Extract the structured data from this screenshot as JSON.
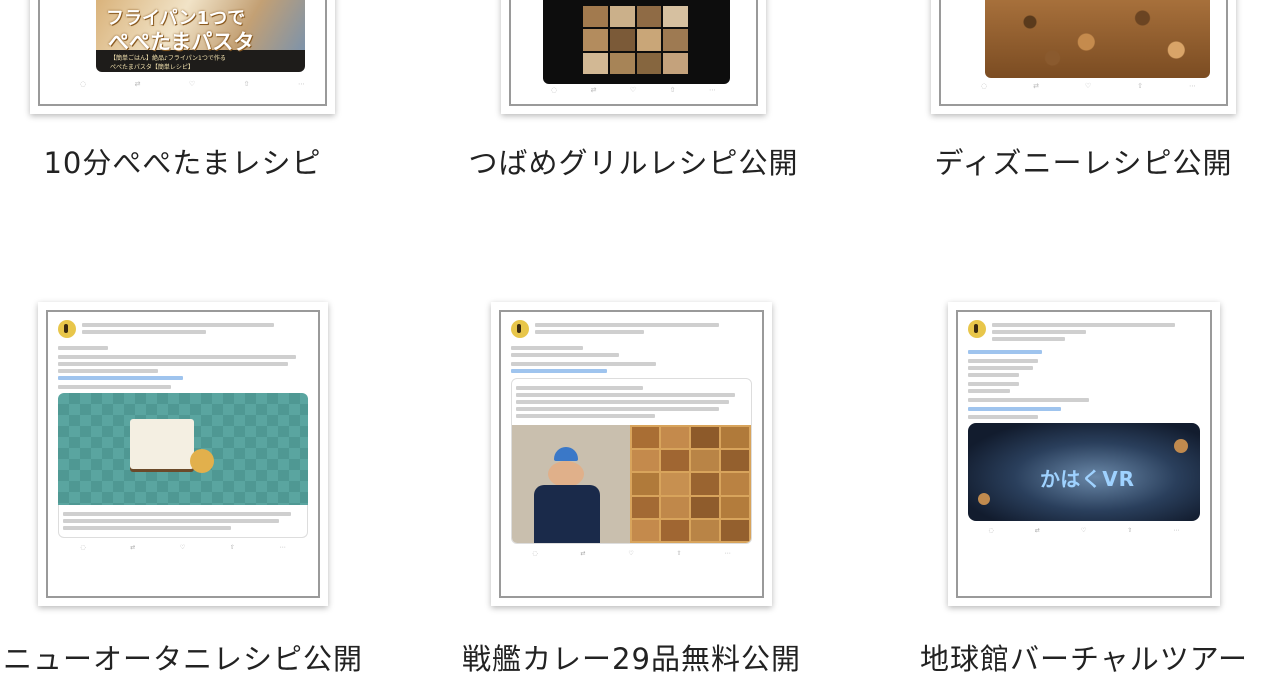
{
  "cards": [
    {
      "caption": "10分ぺぺたまレシピ",
      "thumb_text_1": "フライパン1つで",
      "thumb_text_2": "ぺぺたまパスタ",
      "thumb_text_3": "【簡単ごはん】絶品♪フライパン1つで作る",
      "thumb_text_4": "ぺぺたまパスタ【簡単レシピ】"
    },
    {
      "caption": "つばめグリルレシピ公開"
    },
    {
      "caption": "ディズニーレシピ公開"
    },
    {
      "caption": "ニューオータニレシピ公開"
    },
    {
      "caption": "戦艦カレー29品無料公開"
    },
    {
      "caption": "地球館バーチャルツアー",
      "thumb_text": "かはくVR"
    }
  ],
  "colors": {
    "link": "#3b8ad8",
    "teal": "#5aa5a0",
    "navy": "#1a2a4a",
    "tan": "#b07a3a"
  }
}
